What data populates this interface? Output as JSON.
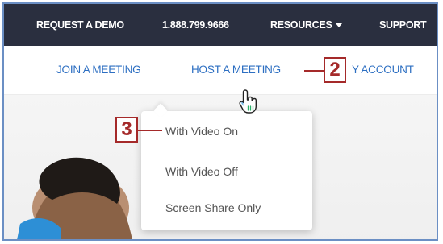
{
  "topbar": {
    "items": [
      {
        "label": "REQUEST A DEMO"
      },
      {
        "label": "1.888.799.9666"
      },
      {
        "label": "RESOURCES"
      },
      {
        "label": "SUPPORT"
      }
    ],
    "background": "#2a2f3f"
  },
  "nav": {
    "items": [
      {
        "label": "JOIN A MEETING"
      },
      {
        "label": "HOST A MEETING"
      },
      {
        "label": "Y ACCOUNT"
      }
    ],
    "link_color": "#2d6fc2"
  },
  "host_dropdown": {
    "items": [
      {
        "label": "With Video On"
      },
      {
        "label": "With Video Off"
      },
      {
        "label": "Screen Share Only"
      }
    ]
  },
  "annotations": {
    "callout_2": "2",
    "callout_3": "3",
    "color": "#a52a2a"
  },
  "icons": {
    "cursor": "hand-pointer-icon",
    "resources_caret": "caret-down-icon"
  }
}
